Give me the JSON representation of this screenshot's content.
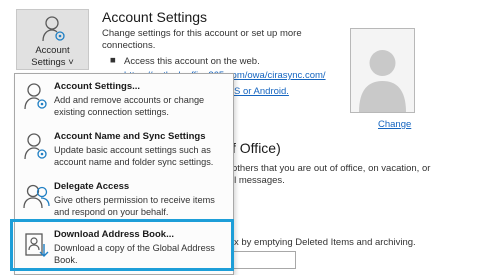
{
  "account_button": {
    "line1": "Account",
    "line2": "Settings ˅",
    "icon": "person-gear-icon"
  },
  "section": {
    "title": "Account Settings",
    "desc_line1": "Change settings for this account or set up more",
    "desc_line2": "connections.",
    "bullet_text": "Access this account on the web.",
    "web_link": "https://outlook.office365.com/owa/cirasync.com/",
    "link_tail": "S or Android."
  },
  "profile": {
    "change_label": "Change",
    "icon": "person-silhouette-icon"
  },
  "ooo": {
    "title": "f Office)",
    "line1": "others that you are out of office, on vacation, or",
    "line2": "il messages.",
    "cleanup_text": "x by emptying Deleted Items and archiving."
  },
  "menu": {
    "items": [
      {
        "title": "Account Settings...",
        "desc": "Add and remove accounts or change existing connection settings.",
        "icon": "person-gear-icon"
      },
      {
        "title": "Account Name and Sync Settings",
        "desc": "Update basic account settings such as account name and folder sync settings.",
        "icon": "person-gear-icon"
      },
      {
        "title": "Delegate Access",
        "desc": "Give others permission to receive items and respond on your behalf.",
        "icon": "people-icon"
      },
      {
        "title": "Download Address Book...",
        "desc": "Download a copy of the Global Address Book.",
        "icon": "address-book-download-icon"
      }
    ]
  },
  "colors": {
    "highlight": "#1d9ed8",
    "link": "#1565c0"
  }
}
